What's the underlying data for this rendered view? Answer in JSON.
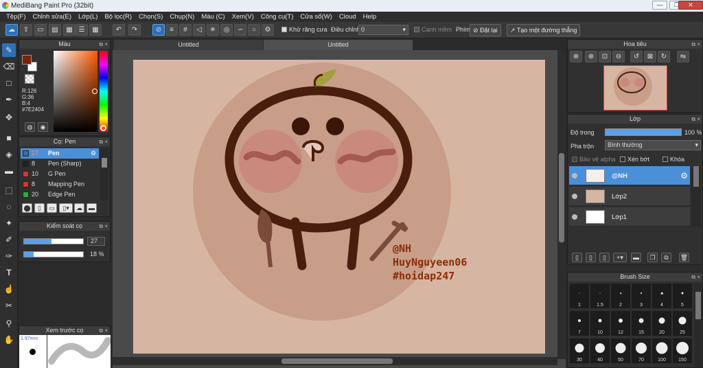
{
  "app": {
    "title": "MediBang Paint Pro (32bit)"
  },
  "menu": [
    "Tệp(F)",
    "Chỉnh sửa(E)",
    "Lớp(L)",
    "Bộ lọc(R)",
    "Chọn(S)",
    "Chụp(N)",
    "Màu (C)",
    "Xem(V)",
    "Công cụ(T)",
    "Cửa sổ(W)",
    "Cloud",
    "Help"
  ],
  "toolbar": {
    "antialias_label": "Khử răng cưa",
    "correction_label": "Điều chỉnh",
    "correction_value": "0",
    "edge_label": "Cạnh mềm",
    "key_label": "Phím",
    "reset_label": "Đặt lại",
    "make_line_label": "Tạo một đường thẳng"
  },
  "color_panel": {
    "title": "Màu",
    "r": "R:126",
    "g": "G:36",
    "b": "B:4",
    "hex": "#7E2404",
    "primary_color": "#7e2404"
  },
  "brush_panel": {
    "title": "Cọ: Pen",
    "brushes": [
      {
        "size": "27",
        "name": "Pen",
        "color": "#2f6fb3"
      },
      {
        "size": "8",
        "name": "Pen (Sharp)",
        "color": "#222222"
      },
      {
        "size": "10",
        "name": "G Pen",
        "color": "#e03030"
      },
      {
        "size": "8",
        "name": "Mapping Pen",
        "color": "#e03030"
      },
      {
        "size": "20",
        "name": "Edge Pen",
        "color": "#20b040"
      }
    ]
  },
  "brush_control": {
    "title": "Kiểm soát cọ",
    "size_value": "27",
    "opacity_value": "18 %",
    "size_fraction": 0.46,
    "opacity_fraction": 0.16
  },
  "preview": {
    "title": "Xem trước cọ",
    "size": "1.97mm"
  },
  "canvas": {
    "tabs": [
      "Untitled",
      "Untitled"
    ],
    "signature_lines": [
      "@NH",
      "HuyNguyeen06",
      "#hoidap247"
    ]
  },
  "navigator": {
    "title": "Hoa tiêu"
  },
  "layers": {
    "title": "Lớp",
    "opacity_label": "Độ trong",
    "opacity_value": "100 %",
    "blend_label": "Pha trộn",
    "blend_value": "Bình thường",
    "protect_alpha": "Bảo vệ alpha",
    "clipping": "Xén bớt",
    "lock": "Khóa",
    "items": [
      {
        "name": "@NH",
        "selected": true
      },
      {
        "name": "Lớp2",
        "selected": false
      },
      {
        "name": "Lớp1",
        "selected": false
      }
    ]
  },
  "brush_size": {
    "title": "Brush Size",
    "sizes": [
      "1",
      "1.5",
      "2",
      "3",
      "4",
      "5",
      "7",
      "10",
      "12",
      "15",
      "20",
      "25",
      "30",
      "40",
      "50",
      "70",
      "100",
      "150"
    ]
  }
}
